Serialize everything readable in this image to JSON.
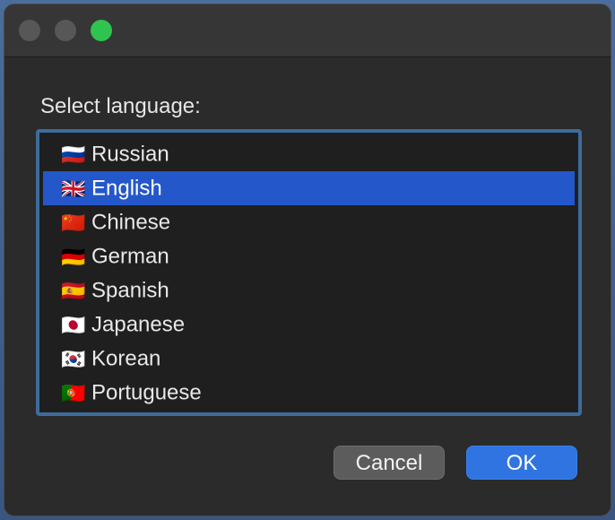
{
  "dialog": {
    "prompt": "Select language:",
    "languages": [
      {
        "flag": "🇷🇺",
        "label": "Russian",
        "selected": false
      },
      {
        "flag": "🇬🇧",
        "label": "English",
        "selected": true
      },
      {
        "flag": "🇨🇳",
        "label": "Chinese",
        "selected": false
      },
      {
        "flag": "🇩🇪",
        "label": "German",
        "selected": false
      },
      {
        "flag": "🇪🇸",
        "label": "Spanish",
        "selected": false
      },
      {
        "flag": "🇯🇵",
        "label": "Japanese",
        "selected": false
      },
      {
        "flag": "🇰🇷",
        "label": "Korean",
        "selected": false
      },
      {
        "flag": "🇵🇹",
        "label": "Portuguese",
        "selected": false
      }
    ],
    "cancel_label": "Cancel",
    "ok_label": "OK"
  },
  "colors": {
    "selection": "#2457c9",
    "ok_button": "#2f74e0",
    "zoom_button": "#2fc350"
  }
}
